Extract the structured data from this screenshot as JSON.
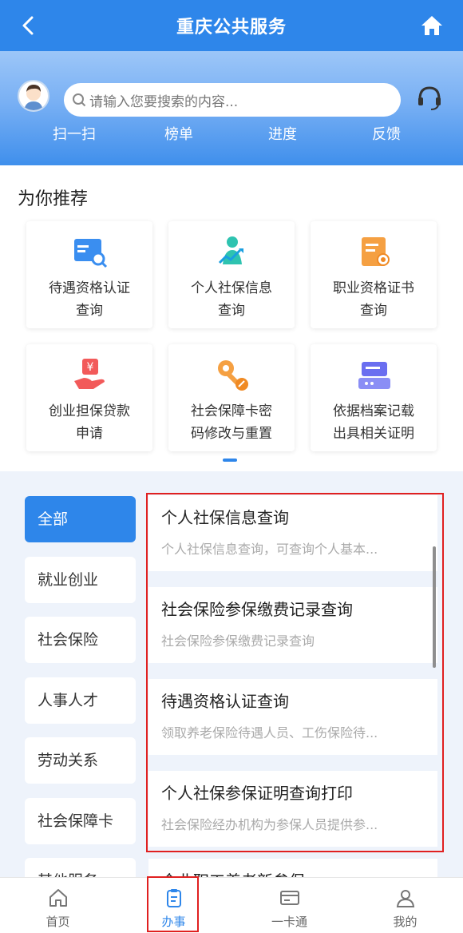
{
  "header": {
    "title": "重庆公共服务",
    "back_icon": "chevron-left-icon",
    "home_icon": "home-icon"
  },
  "search": {
    "placeholder": "请输入您要搜索的内容..."
  },
  "quick_actions": [
    "扫一扫",
    "榜单",
    "进度",
    "反馈"
  ],
  "recommend": {
    "title": "为你推荐",
    "cards": [
      {
        "line1": "待遇资格认证",
        "line2": "查询",
        "icon": "id-card-search-icon"
      },
      {
        "line1": "个人社保信息",
        "line2": "查询",
        "icon": "person-growth-icon"
      },
      {
        "line1": "职业资格证书",
        "line2": "查询",
        "icon": "certificate-icon"
      },
      {
        "line1": "创业担保贷款",
        "line2": "申请",
        "icon": "yuan-hand-icon"
      },
      {
        "line1": "社会保障卡密",
        "line2": "码修改与重置",
        "icon": "key-edit-icon"
      },
      {
        "line1": "依据档案记载",
        "line2": "出具相关证明",
        "icon": "archive-icon"
      }
    ]
  },
  "categories": [
    "全部",
    "就业创业",
    "社会保险",
    "人事人才",
    "劳动关系",
    "社会保障卡",
    "其他服务"
  ],
  "services": [
    {
      "title": "个人社保信息查询",
      "desc": "个人社保信息查询，可查询个人基本..."
    },
    {
      "title": "社会保险参保缴费记录查询",
      "desc": "社会保险参保缴费记录查询"
    },
    {
      "title": "待遇资格认证查询",
      "desc": "领取养老保险待遇人员、工伤保险待..."
    },
    {
      "title": "个人社保参保证明查询打印",
      "desc": "社会保险经办机构为参保人员提供参..."
    },
    {
      "title": "企业职工养老新参保",
      "desc": ""
    }
  ],
  "bottom_nav": [
    {
      "label": "首页",
      "icon": "home-outline-icon"
    },
    {
      "label": "办事",
      "icon": "clipboard-icon"
    },
    {
      "label": "一卡通",
      "icon": "card-icon"
    },
    {
      "label": "我的",
      "icon": "user-icon"
    }
  ],
  "colors": {
    "primary": "#2e86ea",
    "highlight_border": "#e02020"
  }
}
